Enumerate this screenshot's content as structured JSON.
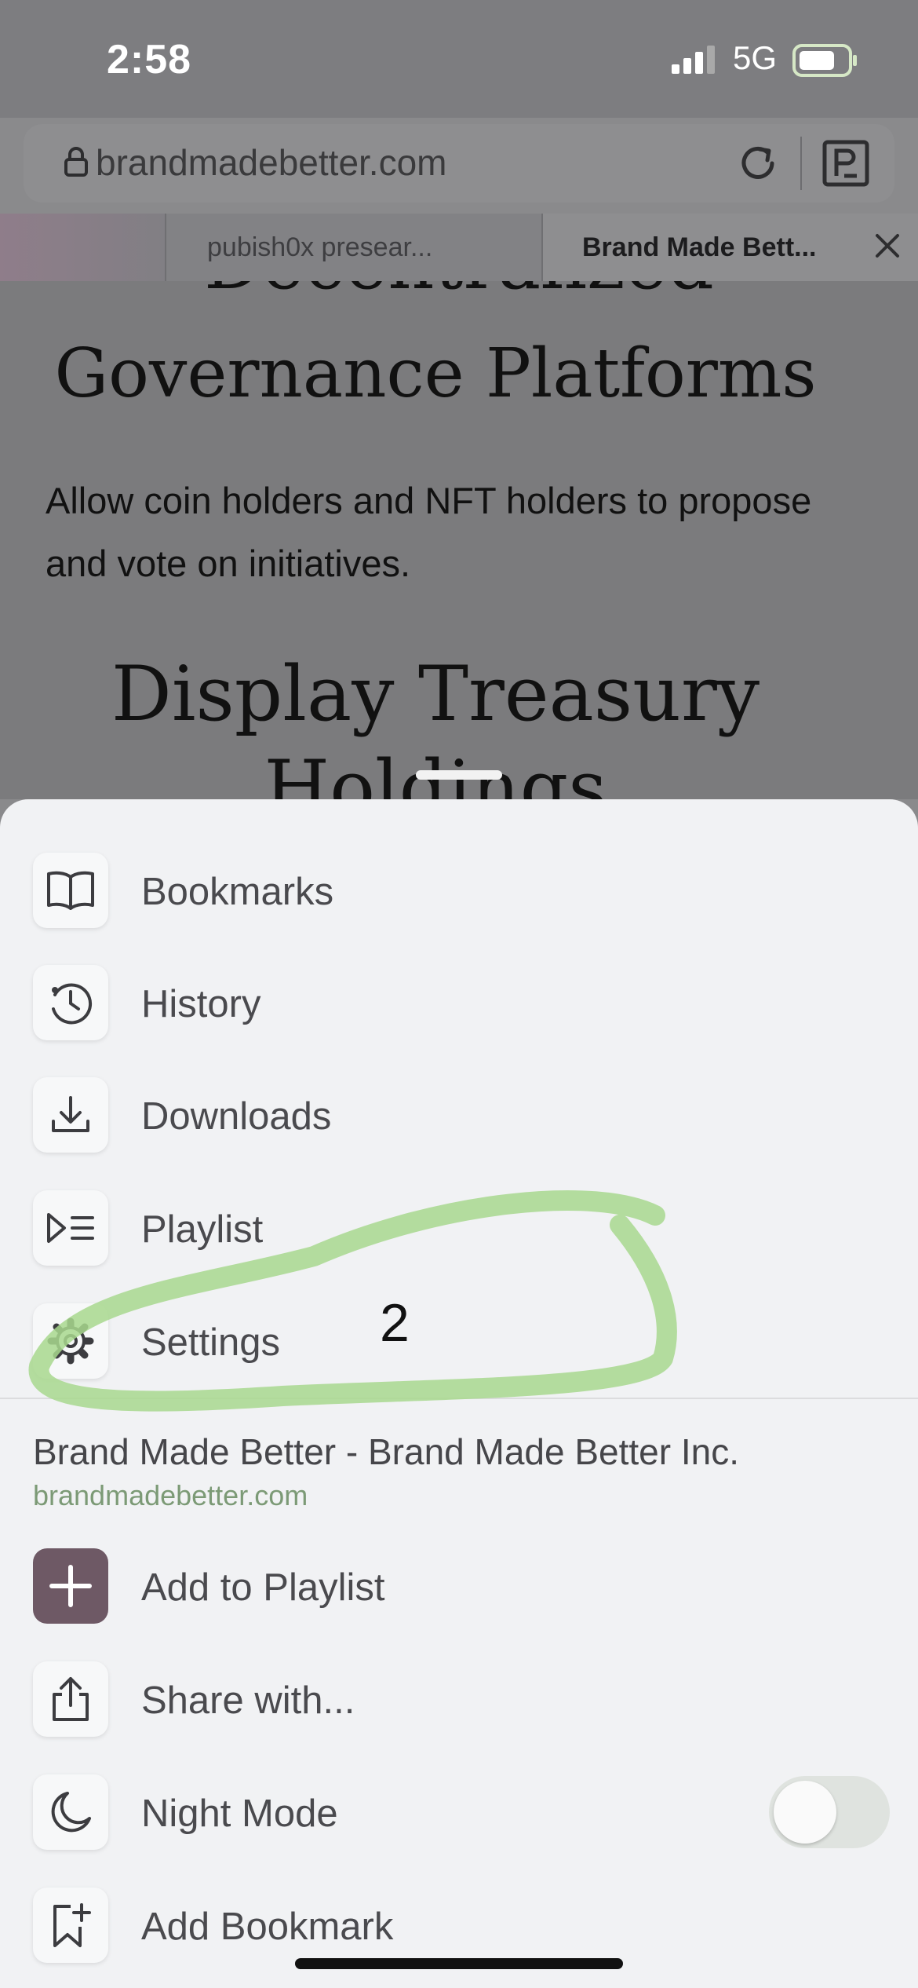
{
  "status_bar": {
    "time": "2:58",
    "network": "5G",
    "icons": [
      "signal-icon",
      "battery-icon"
    ]
  },
  "browser": {
    "url": "brandmadebetter.com",
    "icons": [
      "lock-icon",
      "reload-icon",
      "reader-icon"
    ],
    "tabs": [
      {
        "title": ""
      },
      {
        "title": "pubish0x presear..."
      },
      {
        "title": "Brand Made Bett...",
        "active": true
      }
    ]
  },
  "page": {
    "heading_partial": "Decentralized",
    "heading1": "Governance Platforms",
    "paragraph": "Allow coin holders and NFT holders to propose and vote on initiatives.",
    "heading2_line1": "Display Treasury",
    "heading2_line2": "Holdings"
  },
  "menu": {
    "items": [
      {
        "label": "Bookmarks",
        "icon": "book-icon"
      },
      {
        "label": "History",
        "icon": "history-icon"
      },
      {
        "label": "Downloads",
        "icon": "download-icon"
      },
      {
        "label": "Playlist",
        "icon": "playlist-icon"
      },
      {
        "label": "Settings",
        "icon": "gear-icon"
      }
    ],
    "site": {
      "title": "Brand Made Better - Brand Made Better Inc.",
      "url": "brandmadebetter.com"
    },
    "actions": [
      {
        "label": "Add to Playlist",
        "icon": "plus-icon"
      },
      {
        "label": "Share with...",
        "icon": "share-icon"
      },
      {
        "label": "Night Mode",
        "icon": "moon-icon",
        "toggle_on": false
      },
      {
        "label": "Add Bookmark",
        "icon": "add-bookmark-icon"
      }
    ]
  },
  "annotation": {
    "number": "2",
    "color": "#a8d88e"
  },
  "colors": {
    "playlist_accent": "#6e5965",
    "url_green": "#7c9a76"
  }
}
